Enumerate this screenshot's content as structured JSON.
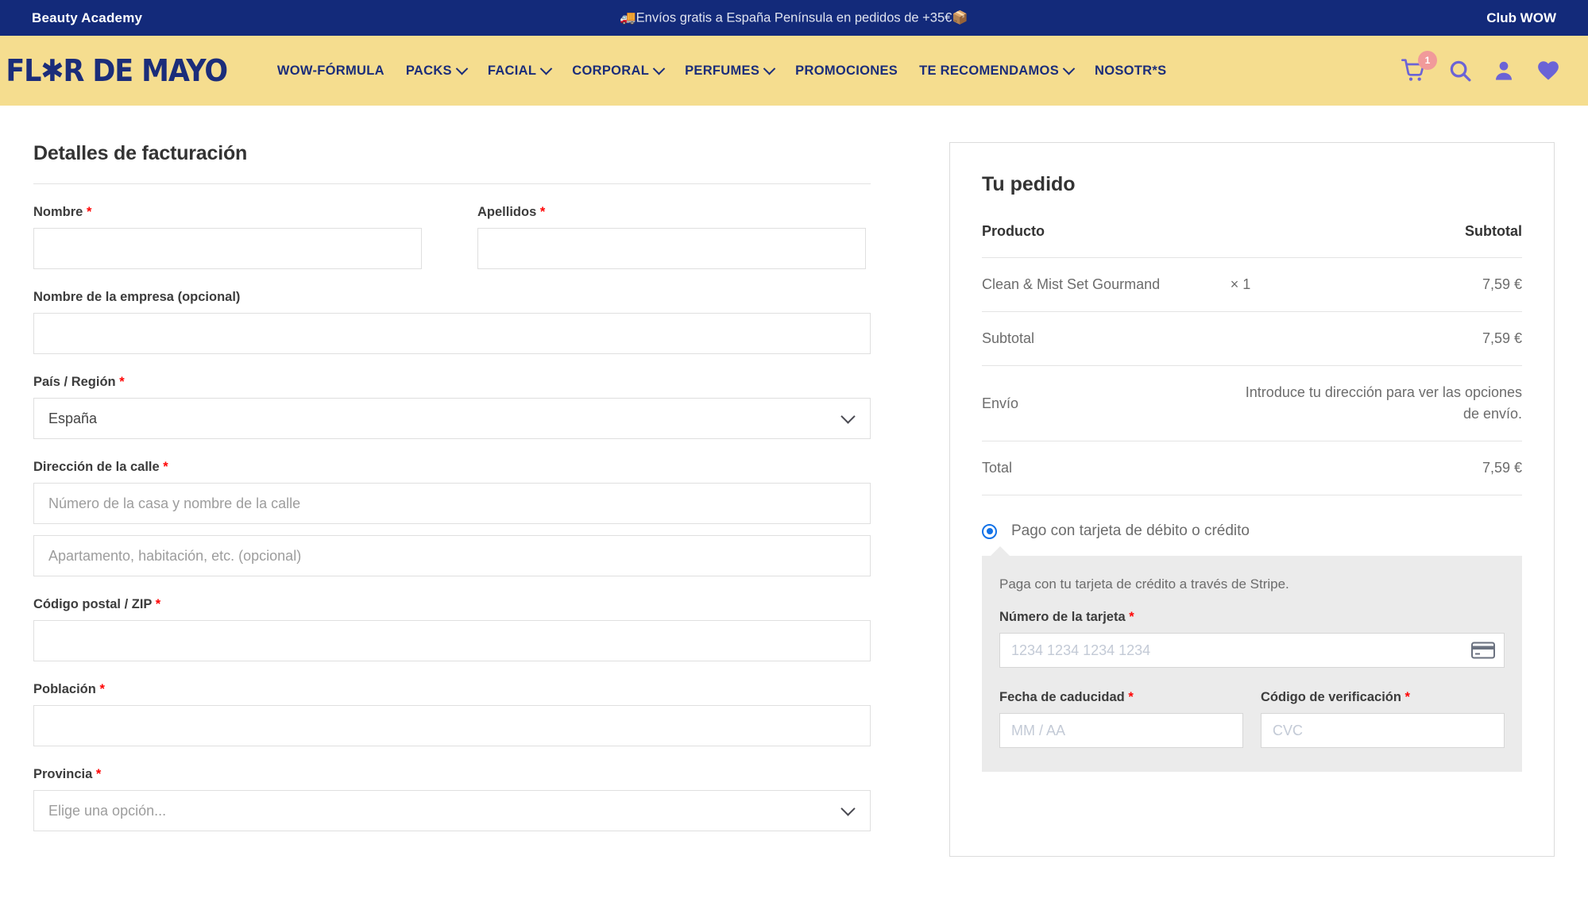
{
  "topbar": {
    "left_label": "Beauty Academy",
    "center_message": "🚚Envíos gratis a España Península en pedidos de +35€📦",
    "right_label": "Club WOW",
    "bg_color": "#132a7a"
  },
  "nav": {
    "logo_text": "FL✱R DE MAYO",
    "bg_color": "#f5dd8f",
    "text_color": "#1b2d7a",
    "items": [
      {
        "label": "WOW-FÓRMULA",
        "has_dropdown": false
      },
      {
        "label": "PACKS",
        "has_dropdown": true
      },
      {
        "label": "FACIAL",
        "has_dropdown": true
      },
      {
        "label": "CORPORAL",
        "has_dropdown": true
      },
      {
        "label": "PERFUMES",
        "has_dropdown": true
      },
      {
        "label": "PROMOCIONES",
        "has_dropdown": false
      },
      {
        "label": "TE RECOMENDAMOS",
        "has_dropdown": true
      },
      {
        "label": "NOSOTR*S",
        "has_dropdown": false
      }
    ],
    "icons": {
      "cart_badge_count": "1",
      "icon_color": "#6b63d6",
      "badge_color": "#f19a9a"
    }
  },
  "billing": {
    "heading": "Detalles de facturación",
    "first_name": {
      "label": "Nombre",
      "required": true,
      "value": "",
      "placeholder": ""
    },
    "last_name": {
      "label": "Apellidos",
      "required": true,
      "value": "",
      "placeholder": ""
    },
    "company": {
      "label": "Nombre de la empresa (opcional)",
      "required": false,
      "value": "",
      "placeholder": ""
    },
    "country": {
      "label": "País / Región",
      "required": true,
      "value": "España",
      "options": [
        "España"
      ]
    },
    "street": {
      "label": "Dirección de la calle",
      "required": true,
      "line1_placeholder": "Número de la casa y nombre de la calle",
      "line1_value": "",
      "line2_placeholder": "Apartamento, habitación, etc. (opcional)",
      "line2_value": ""
    },
    "postcode": {
      "label": "Código postal / ZIP",
      "required": true,
      "value": "",
      "placeholder": ""
    },
    "city": {
      "label": "Población",
      "required": true,
      "value": "",
      "placeholder": ""
    },
    "province": {
      "label": "Provincia",
      "required": true,
      "value": "",
      "placeholder": "Elige una opción..."
    }
  },
  "order": {
    "heading": "Tu pedido",
    "col_product": "Producto",
    "col_subtotal": "Subtotal",
    "items": [
      {
        "name": "Clean & Mist Set Gourmand",
        "quantity": "× 1",
        "subtotal": "7,59 €"
      }
    ],
    "subtotal_label": "Subtotal",
    "subtotal_value": "7,59 €",
    "shipping_label": "Envío",
    "shipping_value": "Introduce tu dirección para ver las opciones de envío.",
    "total_label": "Total",
    "total_value": "7,59 €"
  },
  "payment": {
    "option_label": "Pago con tarjeta de débito o crédito",
    "option_selected": true,
    "radio_color": "#1272e8",
    "stripe_description": "Paga con tu tarjeta de crédito a través de Stripe.",
    "card_number": {
      "label": "Número de la tarjeta",
      "required": true,
      "placeholder": "1234 1234 1234 1234",
      "value": ""
    },
    "expiry": {
      "label": "Fecha de caducidad",
      "required": true,
      "placeholder": "MM / AA",
      "value": ""
    },
    "cvc": {
      "label": "Código de verificación",
      "required": true,
      "placeholder": "CVC",
      "value": ""
    }
  }
}
